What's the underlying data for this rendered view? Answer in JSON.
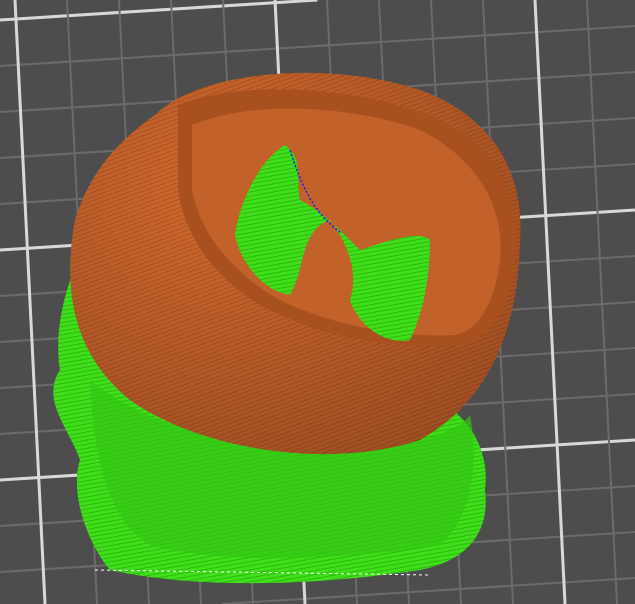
{
  "viewport": {
    "background_color": "#4d4d4d",
    "grid_minor_color": "#6b6b6b",
    "grid_major_color": "#d8d8d8"
  },
  "model": {
    "perimeter_color": "#d2692e",
    "perimeter_shadow_color": "#a9501f",
    "support_color": "#3fe01a",
    "support_shadow_color": "#2aa012",
    "seam_color": "#1a1aff"
  }
}
